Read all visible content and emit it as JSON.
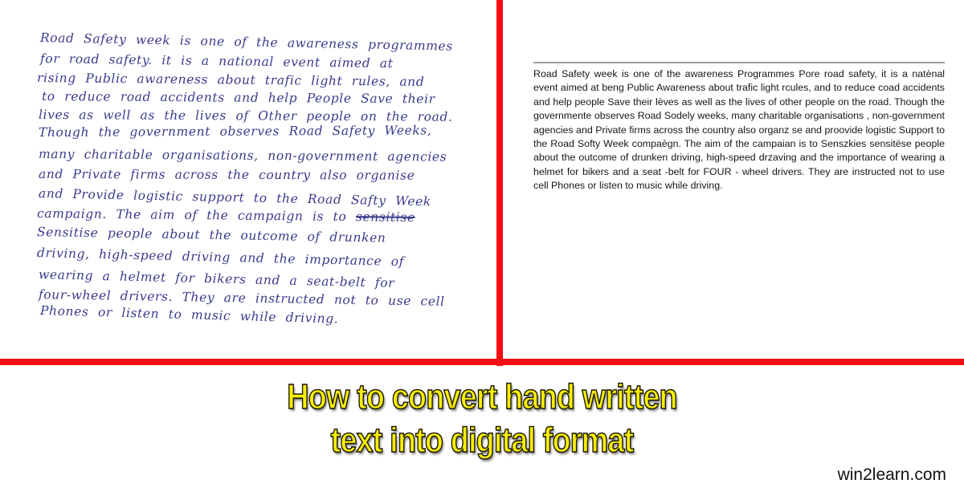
{
  "handwritten": {
    "lines": [
      "Road Safety week is one of the awareness programmes",
      "for road safety. it is a national event aimed at",
      "rising Public awareness about trafic light rules, and",
      "to reduce road accidents and help People Save their",
      "lives as well as the lives of Other people on the road.",
      "Though the government observes Road Safety Weeks,",
      "many charitable organisations, non-government agencies",
      "and Private firms across the country also organise",
      "and Provide logistic support to the Road Safty Week",
      "campaign. The aim of the campaign is to",
      "Sensitise people about the outcome of drunken",
      "driving, high-speed driving and the importance of",
      "wearing a helmet for bikers and a seat-belt for",
      "four-wheel drivers. They are instructed not to use cell",
      "Phones or listen to music while driving."
    ],
    "struck_word": "sensitise",
    "ink_color": "#3b3a8c"
  },
  "typed": {
    "text": "Road Safety week is one of the awareness Programmes Pore road safety, it is a natènal event aimed at beng Public Awareness about trafic light rcules, and to reduce coad accidents and help people Save their lèves as well as the lives of other people on the road. Though the governmente observes Road Sodely weeks, many charitable organisations , non-government agencies and Private firms across the country also organz se and proovide logistic Support to the Road Softy Week compaègn. The aim of the campaian is to Senszkies sensitëse people about the outcome of drunken driving, high-speed drzaving and the importance of wearing a helmet for bikers and a seat -belt for FOUR - wheel drivers. They are instructed not to use cell Phones or listen to music while driving."
  },
  "title": {
    "line1": "How to convert hand written",
    "line2": "text into digital format",
    "fill_color": "#f7ee06"
  },
  "watermark": "win2learn.com",
  "divider_color": "#f40d12"
}
